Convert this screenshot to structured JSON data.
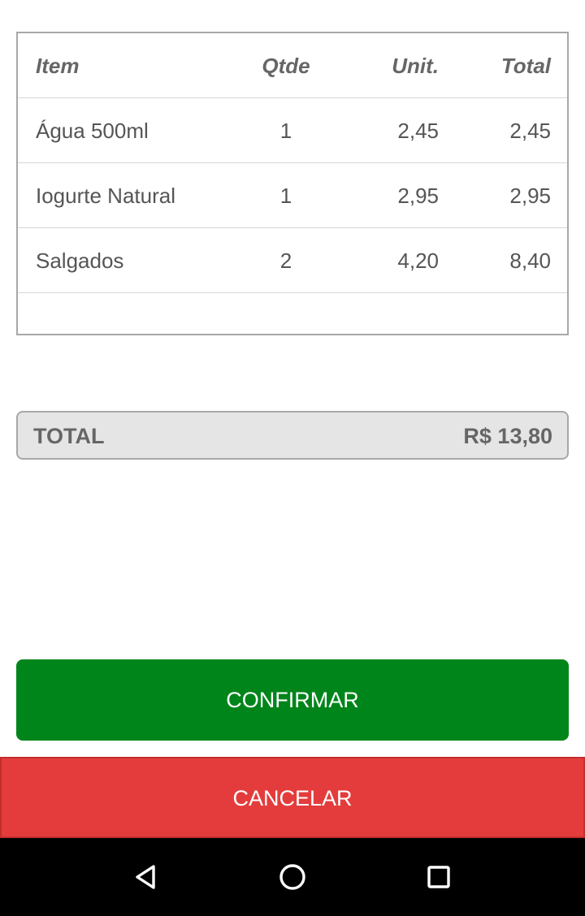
{
  "table": {
    "headers": {
      "item": "Item",
      "qtde": "Qtde",
      "unit": "Unit.",
      "total": "Total"
    },
    "rows": [
      {
        "item": "Água 500ml",
        "qtde": "1",
        "unit": "2,45",
        "total": "2,45"
      },
      {
        "item": "Iogurte Natural",
        "qtde": "1",
        "unit": "2,95",
        "total": "2,95"
      },
      {
        "item": "Salgados",
        "qtde": "2",
        "unit": "4,20",
        "total": "8,40"
      }
    ]
  },
  "summary": {
    "label": "TOTAL",
    "value": "R$ 13,80"
  },
  "actions": {
    "confirm_label": "CONFIRMAR",
    "cancel_label": "CANCELAR"
  },
  "colors": {
    "confirm": "#00851a",
    "cancel": "#e43c3c",
    "total_bar": "#e5e5e5",
    "nav_bar": "#000000"
  },
  "navigation": {
    "back_icon": "back-triangle-icon",
    "home_icon": "home-circle-icon",
    "recent_icon": "recent-apps-square-icon"
  }
}
